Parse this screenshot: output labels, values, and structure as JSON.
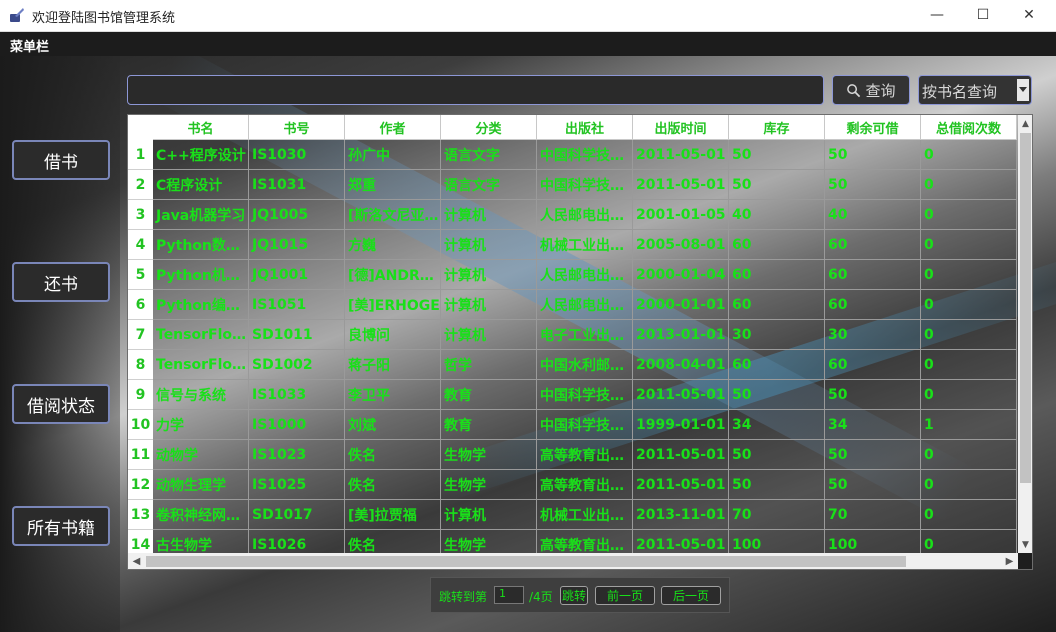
{
  "window": {
    "title": "欢迎登陆图书馆管理系统",
    "minimize": "—",
    "maximize": "☐",
    "close": "✕"
  },
  "menubar": {
    "label": "菜单栏"
  },
  "nav": {
    "borrow": "借书",
    "return": "还书",
    "status": "借阅状态",
    "all_books": "所有书籍"
  },
  "search": {
    "value": "",
    "button": "查询",
    "mode": "按书名查询"
  },
  "table": {
    "headers": [
      "书名",
      "书号",
      "作者",
      "分类",
      "出版社",
      "出版时间",
      "库存",
      "剩余可借",
      "总借阅次数"
    ],
    "rows": [
      [
        "C++程序设计",
        "IS1030",
        "孙广中",
        "语言文字",
        "中国科学技…",
        "2011-05-01",
        "50",
        "50",
        "0"
      ],
      [
        "C程序设计",
        "IS1031",
        "郑重",
        "语言文字",
        "中国科学技…",
        "2011-05-01",
        "50",
        "50",
        "0"
      ],
      [
        "Java机器学习",
        "JQ1005",
        "[斯洛文尼亚…",
        "计算机",
        "人民邮电出…",
        "2001-01-05",
        "40",
        "40",
        "0"
      ],
      [
        "Python数…",
        "JQ1015",
        "方巍",
        "计算机",
        "机械工业出…",
        "2005-08-01",
        "60",
        "60",
        "0"
      ],
      [
        "Python机…",
        "JQ1001",
        "[德]ANDR…",
        "计算机",
        "人民邮电出…",
        "2000-01-04",
        "60",
        "60",
        "0"
      ],
      [
        "Python编…",
        "IS1051",
        "[美]ERHOGE",
        "计算机",
        "人民邮电出…",
        "2000-01-01",
        "60",
        "60",
        "0"
      ],
      [
        "TensorFlo…",
        "SD1011",
        "良博问",
        "计算机",
        "电子工业出…",
        "2013-01-01",
        "30",
        "30",
        "0"
      ],
      [
        "TensorFlo…",
        "SD1002",
        "蒋子阳",
        "哲学",
        "中国水利邮…",
        "2008-04-01",
        "60",
        "60",
        "0"
      ],
      [
        "信号与系统",
        "IS1033",
        "李卫平",
        "教育",
        "中国科学技…",
        "2011-05-01",
        "50",
        "50",
        "0"
      ],
      [
        "力学",
        "IS1000",
        "刘斌",
        "教育",
        "中国科学技…",
        "1999-01-01",
        "34",
        "34",
        "1"
      ],
      [
        "动物学",
        "IS1023",
        "佚名",
        "生物学",
        "高等教育出…",
        "2011-05-01",
        "50",
        "50",
        "0"
      ],
      [
        "动物生理学",
        "IS1025",
        "佚名",
        "生物学",
        "高等教育出…",
        "2011-05-01",
        "50",
        "50",
        "0"
      ],
      [
        "卷积神经网…",
        "SD1017",
        "[美]拉贾福",
        "计算机",
        "机械工业出…",
        "2013-11-01",
        "70",
        "70",
        "0"
      ],
      [
        "古生物学",
        "IS1026",
        "佚名",
        "生物学",
        "高等教育出…",
        "2011-05-01",
        "100",
        "100",
        "0"
      ]
    ]
  },
  "pager": {
    "jump_prefix": "跳转到第",
    "page_value": "1",
    "page_suffix": "/4页",
    "jump_button": "跳转",
    "prev_button": "前一页",
    "next_button": "后一页"
  },
  "colors": {
    "cell_text": "#19e019",
    "header_text": "#22c322",
    "button_border": "#7a86b8"
  }
}
